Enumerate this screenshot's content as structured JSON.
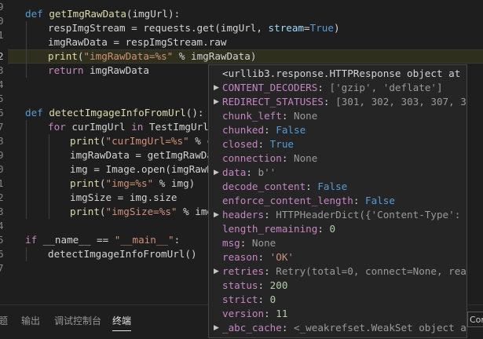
{
  "gutter_numbers": [
    "9",
    "0",
    "1",
    "2",
    "3",
    "4",
    "5",
    "6",
    "7",
    "8",
    "9",
    "0",
    "1",
    "2",
    "3",
    "4",
    "5",
    "6",
    "7",
    "8"
  ],
  "code": {
    "l1": {
      "kw": "def",
      "fn": "getImgRawData",
      "rest": "(imgUrl):"
    },
    "l2": {
      "a": "respImgStream = requests.get(imgUrl, ",
      "b": "stream",
      "c": "=",
      "d": "True",
      "e": ")"
    },
    "l3": {
      "a": "imgRawData = respImgStream.raw"
    },
    "l4": {
      "fn": "print",
      "p1": "(",
      "s": "\"imgRawData=%s\"",
      "rest": " % imgRawData)"
    },
    "l5": {
      "kw": "return",
      "rest": " imgRawData"
    },
    "l8": {
      "kw": "def",
      "fn": "detectImgageInfoFromUrl",
      "rest": "():"
    },
    "l9": {
      "kw": "for",
      "a": " curImgUrl ",
      "kw2": "in",
      "b": " TestImgUrlL"
    },
    "l10": {
      "fn": "print",
      "p1": "(",
      "s": "\"curImgUrl=%s\"",
      "rest": " % c"
    },
    "l11": {
      "a": "imgRawData = getImgRawDa"
    },
    "l12": {
      "a": "img = Image.open(imgRawDa"
    },
    "l13": {
      "fn": "print",
      "p1": "(",
      "s": "\"img=%s\"",
      "rest": " % img)"
    },
    "l14": {
      "a": "imgSize = img.size"
    },
    "l15": {
      "fn": "print",
      "p1": "(",
      "s": "\"imgSize=%s\"",
      "rest": " % img"
    },
    "l17": {
      "kw": "if",
      "a": " __name__ == ",
      "s": "\"__main__\"",
      "rest": ":"
    },
    "l18": {
      "a": "detectImgageInfoFromUrl()"
    }
  },
  "hover": {
    "header": "<urllib3.response.HTTPResponse object at",
    "rows": [
      {
        "key": "CONTENT_DECODERS",
        "val": "['gzip', 'deflate']",
        "kind": "plain",
        "expandable": true
      },
      {
        "key": "REDIRECT_STATUSES",
        "val": "[301, 302, 303, 307, 308]",
        "kind": "plain",
        "expandable": true
      },
      {
        "key": "chunk_left",
        "val": "None",
        "kind": "plain",
        "expandable": false
      },
      {
        "key": "chunked",
        "val": "False",
        "kind": "bool",
        "expandable": false
      },
      {
        "key": "closed",
        "val": "True",
        "kind": "bool",
        "expandable": false
      },
      {
        "key": "connection",
        "val": "None",
        "kind": "plain",
        "expandable": false
      },
      {
        "key": "data",
        "val": "b''",
        "kind": "plain",
        "expandable": true
      },
      {
        "key": "decode_content",
        "val": "False",
        "kind": "bool",
        "expandable": false
      },
      {
        "key": "enforce_content_length",
        "val": "False",
        "kind": "bool",
        "expandable": false
      },
      {
        "key": "headers",
        "val": "HTTPHeaderDict({'Content-Type': 'image",
        "kind": "plain",
        "expandable": true
      },
      {
        "key": "length_remaining",
        "val": "0",
        "kind": "num",
        "expandable": false
      },
      {
        "key": "msg",
        "val": "None",
        "kind": "plain",
        "expandable": false
      },
      {
        "key": "reason",
        "val": "'OK'",
        "kind": "str",
        "expandable": false
      },
      {
        "key": "retries",
        "val": "Retry(total=0, connect=None, read=Fals",
        "kind": "plain",
        "expandable": true
      },
      {
        "key": "status",
        "val": "200",
        "kind": "num",
        "expandable": false
      },
      {
        "key": "strict",
        "val": "0",
        "kind": "num",
        "expandable": false
      },
      {
        "key": "version",
        "val": "11",
        "kind": "num",
        "expandable": false
      },
      {
        "key": "_abc_cache",
        "val": "<_weakrefset.WeakSet object at 0x11",
        "kind": "plain",
        "expandable": true
      }
    ]
  },
  "panel": {
    "tabs": [
      "题",
      "输出",
      "调试控制台",
      "终端"
    ],
    "active_tab": "终端",
    "right_label": "Con"
  },
  "colors": {
    "background": "#1e1e1e",
    "keyword": "#569cd6",
    "function": "#dcdcaa",
    "string": "#ce9178",
    "hover_key": "#c586c0",
    "number": "#b5cea8"
  }
}
